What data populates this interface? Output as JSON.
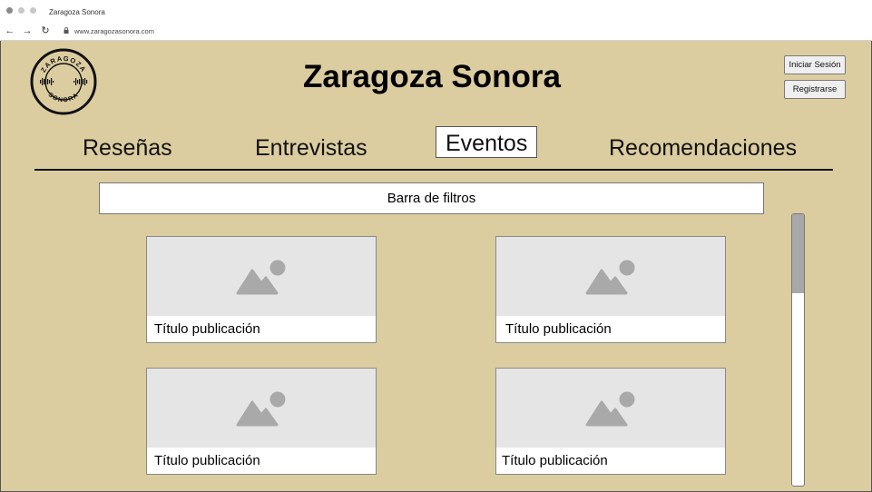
{
  "browser": {
    "tab_title": "Zaragoza Sonora",
    "url": "www.zaragozasonora.com",
    "back_glyph": "←",
    "forward_glyph": "→",
    "reload_glyph": "↻"
  },
  "header": {
    "logo": {
      "top_text": "ZARAGOZA",
      "bottom_text": "SONORA"
    },
    "title": "Zaragoza Sonora",
    "login_label": "Iniciar Sesión",
    "register_label": "Registrarse"
  },
  "nav": {
    "items": [
      {
        "label": "Reseñas"
      },
      {
        "label": "Entrevistas"
      },
      {
        "label": "Eventos",
        "active": true
      },
      {
        "label": "Recomendaciones"
      }
    ]
  },
  "filters": {
    "label": "Barra de filtros"
  },
  "cards": [
    {
      "title": "Título publicación"
    },
    {
      "title": "Título publicación"
    },
    {
      "title": "Título publicación"
    },
    {
      "title": "Título publicación"
    }
  ],
  "colors": {
    "page_background": "#dccda1",
    "placeholder_background": "#e5e5e5",
    "placeholder_icon": "#a9a9a9",
    "scroll_thumb": "#a8a8a8"
  }
}
